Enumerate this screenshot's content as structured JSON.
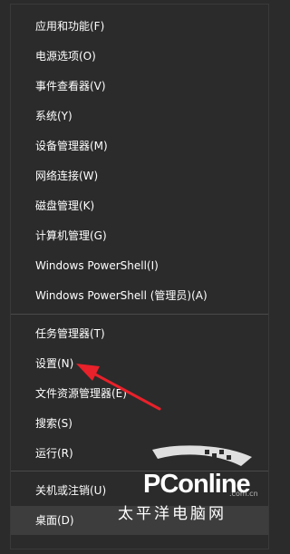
{
  "menu": {
    "items": [
      {
        "label": "应用和功能(F)"
      },
      {
        "label": "电源选项(O)"
      },
      {
        "label": "事件查看器(V)"
      },
      {
        "label": "系统(Y)"
      },
      {
        "label": "设备管理器(M)"
      },
      {
        "label": "网络连接(W)"
      },
      {
        "label": "磁盘管理(K)"
      },
      {
        "label": "计算机管理(G)"
      },
      {
        "label": "Windows PowerShell(I)"
      },
      {
        "label": "Windows PowerShell (管理员)(A)"
      },
      {
        "label": "任务管理器(T)"
      },
      {
        "label": "设置(N)"
      },
      {
        "label": "文件资源管理器(E)"
      },
      {
        "label": "搜索(S)"
      },
      {
        "label": "运行(R)"
      },
      {
        "label": "关机或注销(U)"
      },
      {
        "label": "桌面(D)"
      }
    ],
    "active_item": "桌面(D)"
  },
  "watermark": {
    "brand": "PConline",
    "domain": ".com.cn",
    "chinese": "太平洋电脑网"
  },
  "colors": {
    "menu_bg": "#2b2b2b",
    "text": "#ffffff",
    "separator": "#4a4a4a",
    "highlight": "#3d3d3d",
    "arrow": "#e8212a"
  }
}
